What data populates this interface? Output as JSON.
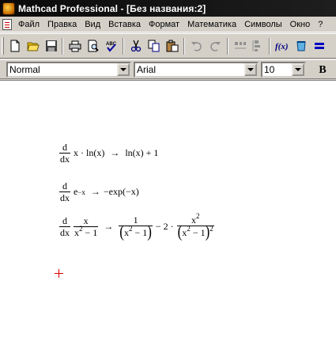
{
  "window": {
    "title": "Mathcad Professional - [Без названия:2]"
  },
  "menu": [
    "Файл",
    "Правка",
    "Вид",
    "Вставка",
    "Формат",
    "Математика",
    "Символы",
    "Окно",
    "?"
  ],
  "toolbar": {
    "buttons": [
      "new-document",
      "open",
      "save",
      "print",
      "print-preview",
      "spell-check",
      "cut",
      "copy",
      "paste",
      "undo",
      "redo",
      "align-horizontal",
      "align-vertical",
      "insert-function",
      "insert-unit",
      "calculate"
    ]
  },
  "format": {
    "style": "Normal",
    "font": "Arial",
    "size": "10",
    "bold_label": "B"
  },
  "worksheet": {
    "expr1": {
      "d": "d",
      "dx": "dx",
      "body": "x · ln(x)",
      "arrow": "→",
      "result": "ln(x) + 1"
    },
    "expr2": {
      "d": "d",
      "dx": "dx",
      "base": "e",
      "exponent": "−x",
      "arrow": "→",
      "result": "−exp(−x)"
    },
    "expr3": {
      "d": "d",
      "dx": "dx",
      "num": "x",
      "den_base": "x",
      "den_exp": "2",
      "den_rest": " − 1",
      "arrow": "→",
      "t1_num": "1",
      "t1_den_base": "x",
      "t1_den_exp": "2",
      "t1_den_rest": " − 1",
      "minus": "− 2 ·",
      "t2_num_base": "x",
      "t2_num_exp": "2",
      "t2_den_base": "x",
      "t2_den_exp": "2",
      "t2_den_rest": " − 1",
      "t2_outer_exp": "2"
    }
  },
  "colors": {
    "cursor": "#e00000",
    "titlebar": "#0a0a0a",
    "chrome": "#d4d0c8"
  }
}
